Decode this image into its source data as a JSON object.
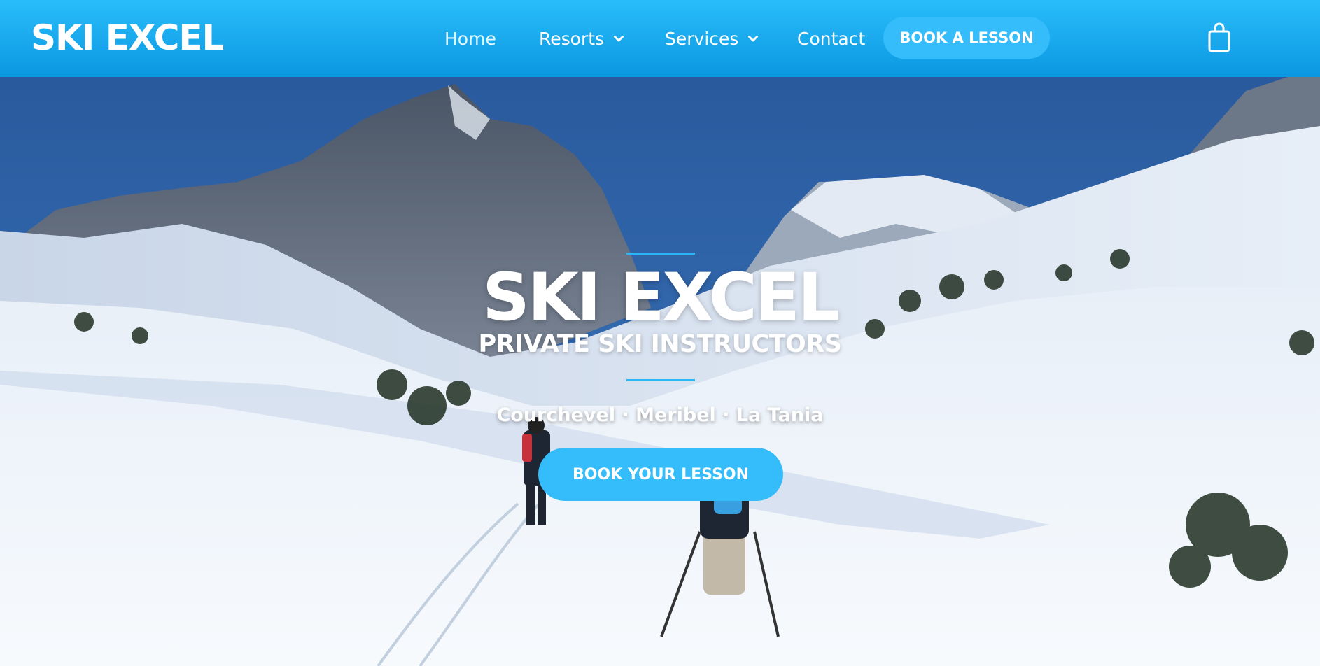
{
  "header": {
    "logo": "SKI EXCEL",
    "nav": {
      "home": "Home",
      "resorts": "Resorts",
      "services": "Services",
      "contact": "Contact"
    },
    "cta_label": "BOOK A LESSON",
    "cart_icon": "shopping-bag-icon"
  },
  "hero": {
    "title": "SKI EXCEL",
    "subtitle": "PRIVATE SKI INSTRUCTORS",
    "locations": "Courchevel · Meribel · La Tania",
    "cta_label": "BOOK YOUR LESSON"
  },
  "colors": {
    "header_top": "#29bdfb",
    "header_bottom": "#0b97e0",
    "accent": "#34bdfa",
    "sky": "#2f63a8"
  }
}
